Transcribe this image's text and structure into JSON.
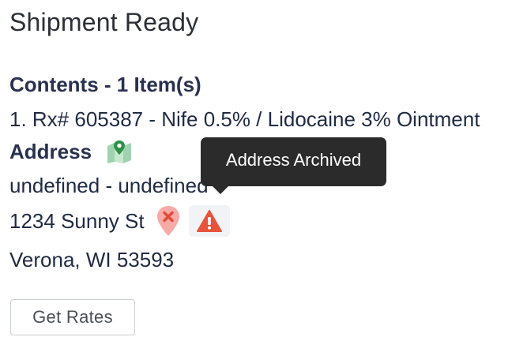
{
  "page": {
    "title": "Shipment Ready"
  },
  "contents": {
    "heading": "Contents - 1 Item(s)",
    "items": [
      {
        "label": "1. Rx# 605387 - Nife 0.5% / Lidocaine 3% Ointment"
      }
    ]
  },
  "address": {
    "heading": "Address",
    "name_line": "undefined - undefined",
    "street": "1234 Sunny St",
    "city_state_zip": "Verona, WI 53593",
    "map_icon": "map-icon",
    "pin_icon": "map-pin-x-icon",
    "warning_icon": "warning-triangle-icon"
  },
  "tooltip": {
    "text": "Address Archived"
  },
  "actions": {
    "get_rates_label": "Get Rates"
  },
  "colors": {
    "heading": "#28324f",
    "text": "#1f2a44",
    "map_green": "#3c9a4f",
    "pin_red": "#f4a3a0",
    "warning_red": "#e8533b",
    "tooltip_bg": "#2b2b2b"
  }
}
